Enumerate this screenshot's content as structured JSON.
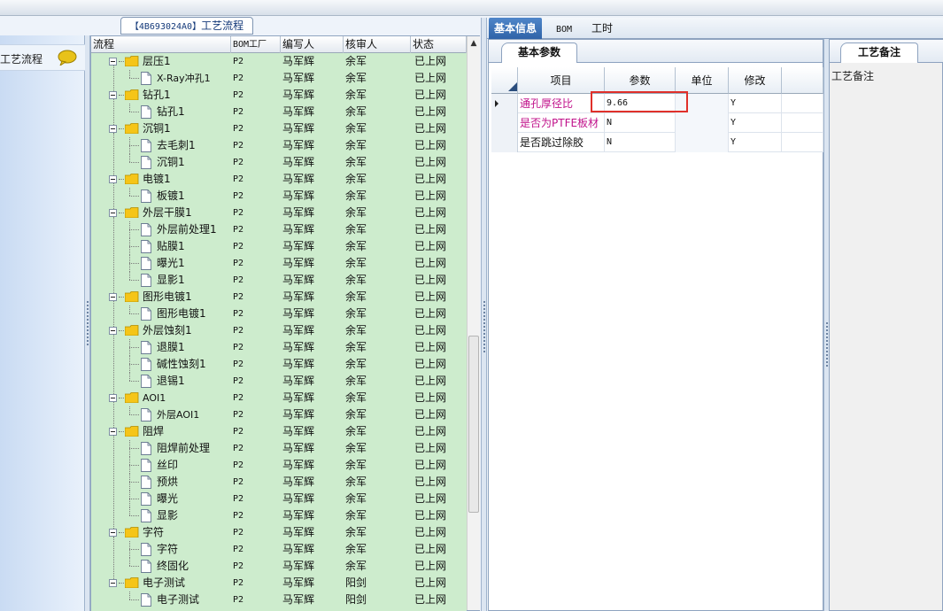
{
  "left": {
    "item_label": "工艺流程"
  },
  "middle": {
    "caption_code": "【4B693024A0】",
    "caption_title": "工艺流程",
    "columns": [
      "流程",
      "BOM工厂",
      "编写人",
      "核审人",
      "状态"
    ],
    "rows": [
      {
        "level": 0,
        "name": "层压1",
        "bom": "P2",
        "writer": "马军辉",
        "reviewer": "余军",
        "status": "已上网"
      },
      {
        "level": 1,
        "name": "X-Ray冲孔1",
        "bom": "P2",
        "writer": "马军辉",
        "reviewer": "余军",
        "status": "已上网"
      },
      {
        "level": 0,
        "name": "钻孔1",
        "bom": "P2",
        "writer": "马军辉",
        "reviewer": "余军",
        "status": "已上网"
      },
      {
        "level": 1,
        "name": "钻孔1",
        "bom": "P2",
        "writer": "马军辉",
        "reviewer": "余军",
        "status": "已上网"
      },
      {
        "level": 0,
        "name": "沉铜1",
        "bom": "P2",
        "writer": "马军辉",
        "reviewer": "余军",
        "status": "已上网"
      },
      {
        "level": 1,
        "name": "去毛刺1",
        "bom": "P2",
        "writer": "马军辉",
        "reviewer": "余军",
        "status": "已上网"
      },
      {
        "level": 1,
        "name": "沉铜1",
        "bom": "P2",
        "writer": "马军辉",
        "reviewer": "余军",
        "status": "已上网"
      },
      {
        "level": 0,
        "name": "电镀1",
        "bom": "P2",
        "writer": "马军辉",
        "reviewer": "余军",
        "status": "已上网"
      },
      {
        "level": 1,
        "name": "板镀1",
        "bom": "P2",
        "writer": "马军辉",
        "reviewer": "余军",
        "status": "已上网"
      },
      {
        "level": 0,
        "name": "外层干膜1",
        "bom": "P2",
        "writer": "马军辉",
        "reviewer": "余军",
        "status": "已上网"
      },
      {
        "level": 1,
        "name": "外层前处理1",
        "bom": "P2",
        "writer": "马军辉",
        "reviewer": "余军",
        "status": "已上网"
      },
      {
        "level": 1,
        "name": "贴膜1",
        "bom": "P2",
        "writer": "马军辉",
        "reviewer": "余军",
        "status": "已上网"
      },
      {
        "level": 1,
        "name": "曝光1",
        "bom": "P2",
        "writer": "马军辉",
        "reviewer": "余军",
        "status": "已上网"
      },
      {
        "level": 1,
        "name": "显影1",
        "bom": "P2",
        "writer": "马军辉",
        "reviewer": "余军",
        "status": "已上网"
      },
      {
        "level": 0,
        "name": "图形电镀1",
        "bom": "P2",
        "writer": "马军辉",
        "reviewer": "余军",
        "status": "已上网"
      },
      {
        "level": 1,
        "name": "图形电镀1",
        "bom": "P2",
        "writer": "马军辉",
        "reviewer": "余军",
        "status": "已上网"
      },
      {
        "level": 0,
        "name": "外层蚀刻1",
        "bom": "P2",
        "writer": "马军辉",
        "reviewer": "余军",
        "status": "已上网"
      },
      {
        "level": 1,
        "name": "退膜1",
        "bom": "P2",
        "writer": "马军辉",
        "reviewer": "余军",
        "status": "已上网"
      },
      {
        "level": 1,
        "name": "碱性蚀刻1",
        "bom": "P2",
        "writer": "马军辉",
        "reviewer": "余军",
        "status": "已上网"
      },
      {
        "level": 1,
        "name": "退锡1",
        "bom": "P2",
        "writer": "马军辉",
        "reviewer": "余军",
        "status": "已上网"
      },
      {
        "level": 0,
        "name": "AOI1",
        "bom": "P2",
        "writer": "马军辉",
        "reviewer": "余军",
        "status": "已上网"
      },
      {
        "level": 1,
        "name": "外层AOI1",
        "bom": "P2",
        "writer": "马军辉",
        "reviewer": "余军",
        "status": "已上网"
      },
      {
        "level": 0,
        "name": "阻焊",
        "bom": "P2",
        "writer": "马军辉",
        "reviewer": "余军",
        "status": "已上网"
      },
      {
        "level": 1,
        "name": "阻焊前处理",
        "bom": "P2",
        "writer": "马军辉",
        "reviewer": "余军",
        "status": "已上网"
      },
      {
        "level": 1,
        "name": "丝印",
        "bom": "P2",
        "writer": "马军辉",
        "reviewer": "余军",
        "status": "已上网"
      },
      {
        "level": 1,
        "name": "预烘",
        "bom": "P2",
        "writer": "马军辉",
        "reviewer": "余军",
        "status": "已上网"
      },
      {
        "level": 1,
        "name": "曝光",
        "bom": "P2",
        "writer": "马军辉",
        "reviewer": "余军",
        "status": "已上网"
      },
      {
        "level": 1,
        "name": "显影",
        "bom": "P2",
        "writer": "马军辉",
        "reviewer": "余军",
        "status": "已上网"
      },
      {
        "level": 0,
        "name": "字符",
        "bom": "P2",
        "writer": "马军辉",
        "reviewer": "余军",
        "status": "已上网"
      },
      {
        "level": 1,
        "name": "字符",
        "bom": "P2",
        "writer": "马军辉",
        "reviewer": "余军",
        "status": "已上网"
      },
      {
        "level": 1,
        "name": "终固化",
        "bom": "P2",
        "writer": "马军辉",
        "reviewer": "余军",
        "status": "已上网"
      },
      {
        "level": 0,
        "name": "电子测试",
        "bom": "P2",
        "writer": "马军辉",
        "reviewer": "阳剑",
        "status": "已上网"
      },
      {
        "level": 1,
        "name": "电子测试",
        "bom": "P2",
        "writer": "马军辉",
        "reviewer": "阳剑",
        "status": "已上网"
      }
    ]
  },
  "tabs": [
    "基本信息",
    "BOM",
    "工时"
  ],
  "params": {
    "tab_label": "基本参数",
    "columns": [
      "项目",
      "参数",
      "单位",
      "修改"
    ],
    "rows": [
      {
        "item": "通孔厚径比",
        "value": "9.66",
        "unit": "",
        "modify": "Y",
        "highlight": true
      },
      {
        "item": "是否为PTFE板材",
        "value": "N",
        "unit": "",
        "modify": "Y",
        "highlight": true
      },
      {
        "item": "是否跳过除胶",
        "value": "N",
        "unit": "",
        "modify": "Y",
        "highlight": false
      }
    ]
  },
  "remarks": {
    "tab_label": "工艺备注",
    "label": "工艺备注"
  },
  "colors": {
    "tree_bg": "#cdeccd",
    "accent_tab": "#2f63a8",
    "highlight_text": "#c0108a",
    "highlight_box": "#e0302a"
  }
}
